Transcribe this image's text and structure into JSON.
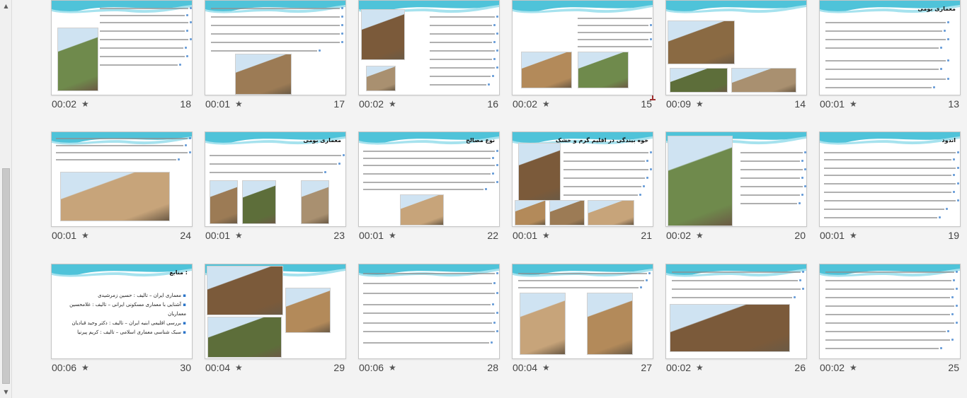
{
  "slides": [
    {
      "num": "13",
      "duration": "00:01",
      "title": "معماری بومی"
    },
    {
      "num": "14",
      "duration": "00:09",
      "title": ""
    },
    {
      "num": "15",
      "duration": "00:02",
      "title": ""
    },
    {
      "num": "16",
      "duration": "00:02",
      "title": ""
    },
    {
      "num": "17",
      "duration": "00:01",
      "title": ""
    },
    {
      "num": "18",
      "duration": "00:02",
      "title": ""
    },
    {
      "num": "19",
      "duration": "00:01",
      "title": "اندود"
    },
    {
      "num": "20",
      "duration": "00:02",
      "title": ""
    },
    {
      "num": "21",
      "duration": "00:01",
      "title": "خوه بیندگی در اقلیم گرم و خشک"
    },
    {
      "num": "22",
      "duration": "00:01",
      "title": "نوع مصالح"
    },
    {
      "num": "23",
      "duration": "00:01",
      "title": "معماری بومی"
    },
    {
      "num": "24",
      "duration": "00:01",
      "title": ""
    },
    {
      "num": "25",
      "duration": "00:02",
      "title": ""
    },
    {
      "num": "26",
      "duration": "00:02",
      "title": ""
    },
    {
      "num": "27",
      "duration": "00:04",
      "title": ""
    },
    {
      "num": "28",
      "duration": "00:06",
      "title": ""
    },
    {
      "num": "29",
      "duration": "00:04",
      "title": ""
    },
    {
      "num": "30",
      "duration": "00:06",
      "title": "منابع :",
      "refs": [
        "معماری ایران – تالیف : حسین زمرشیدی",
        "آشنایی با معماری مسکونی ایرانی – تالیف : غلامحسین معماریان",
        "بررسی اقلیمی ابنیه ایران – تالیف : دکتر وحید قبادیان",
        "سبک شناسی معماری اسلامی – تالیف : کریم پیرنیا"
      ]
    }
  ],
  "icons": {
    "star": "star-icon",
    "scroll_up": "arrow-up-icon",
    "scroll_down": "arrow-down-icon"
  },
  "colors": {
    "accent": "#2b74c8",
    "wave": "#4fc3d9",
    "marker": "#a03232"
  }
}
